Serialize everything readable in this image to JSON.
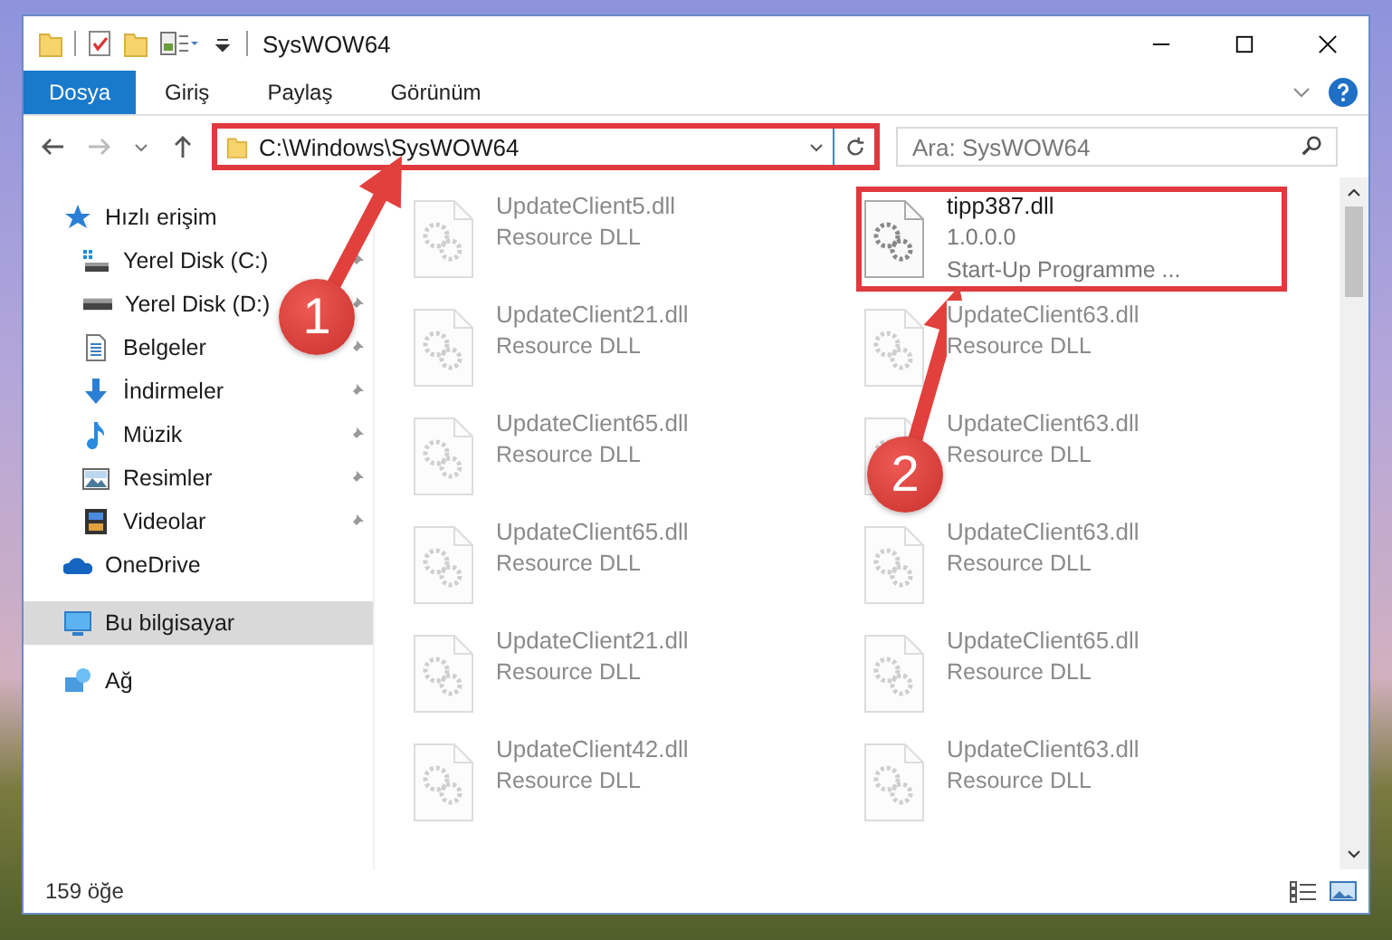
{
  "window": {
    "title": "SysWOW64"
  },
  "ribbon_tabs": [
    {
      "label": "Dosya",
      "selected": true
    },
    {
      "label": "Giriş",
      "selected": false
    },
    {
      "label": "Paylaş",
      "selected": false
    },
    {
      "label": "Görünüm",
      "selected": false
    }
  ],
  "address_bar": {
    "path": "C:\\Windows\\SysWOW64",
    "highlighted": true
  },
  "search": {
    "placeholder": "Ara: SysWOW64"
  },
  "sidebar": {
    "items": [
      {
        "label": "Hızlı erişim",
        "kind": "quick",
        "selected": false,
        "children": [
          {
            "label": "Yerel Disk (C:)",
            "kind": "drive-c",
            "pinned": true,
            "selected": false
          },
          {
            "label": "Yerel Disk (D:)",
            "kind": "drive",
            "pinned": true,
            "selected": false
          },
          {
            "label": "Belgeler",
            "kind": "docs",
            "pinned": true,
            "selected": false
          },
          {
            "label": "İndirmeler",
            "kind": "download",
            "pinned": true,
            "selected": false
          },
          {
            "label": "Müzik",
            "kind": "music",
            "pinned": true,
            "selected": false
          },
          {
            "label": "Resimler",
            "kind": "pictures",
            "pinned": true,
            "selected": false
          },
          {
            "label": "Videolar",
            "kind": "videos",
            "pinned": true,
            "selected": false
          }
        ]
      },
      {
        "label": "OneDrive",
        "kind": "cloud",
        "selected": false
      },
      {
        "label": "Bu bilgisayar",
        "kind": "pc",
        "selected": true
      },
      {
        "label": "Ağ",
        "kind": "network",
        "selected": false
      }
    ]
  },
  "files": [
    {
      "name": "UpdateClient5.dll",
      "lines": [
        "Resource DLL"
      ],
      "dimmed": true,
      "highlighted": false
    },
    {
      "name": "tipp387.dll",
      "lines": [
        "1.0.0.0",
        "Start-Up Programme ..."
      ],
      "dimmed": false,
      "highlighted": true
    },
    {
      "name": "UpdateClient21.dll",
      "lines": [
        "Resource DLL"
      ],
      "dimmed": true,
      "highlighted": false
    },
    {
      "name": "UpdateClient63.dll",
      "lines": [
        "Resource DLL"
      ],
      "dimmed": true,
      "highlighted": false
    },
    {
      "name": "UpdateClient65.dll",
      "lines": [
        "Resource DLL"
      ],
      "dimmed": true,
      "highlighted": false
    },
    {
      "name": "UpdateClient63.dll",
      "lines": [
        "Resource DLL"
      ],
      "dimmed": true,
      "highlighted": false
    },
    {
      "name": "UpdateClient65.dll",
      "lines": [
        "Resource DLL"
      ],
      "dimmed": true,
      "highlighted": false
    },
    {
      "name": "UpdateClient63.dll",
      "lines": [
        "Resource DLL"
      ],
      "dimmed": true,
      "highlighted": false
    },
    {
      "name": "UpdateClient21.dll",
      "lines": [
        "Resource DLL"
      ],
      "dimmed": true,
      "highlighted": false
    },
    {
      "name": "UpdateClient65.dll",
      "lines": [
        "Resource DLL"
      ],
      "dimmed": true,
      "highlighted": false
    },
    {
      "name": "UpdateClient42.dll",
      "lines": [
        "Resource DLL"
      ],
      "dimmed": true,
      "highlighted": false
    },
    {
      "name": "UpdateClient63.dll",
      "lines": [
        "Resource DLL"
      ],
      "dimmed": true,
      "highlighted": false
    }
  ],
  "status_bar": {
    "item_count": "159 öğe"
  },
  "callouts": [
    {
      "number": "1"
    },
    {
      "number": "2"
    }
  ]
}
